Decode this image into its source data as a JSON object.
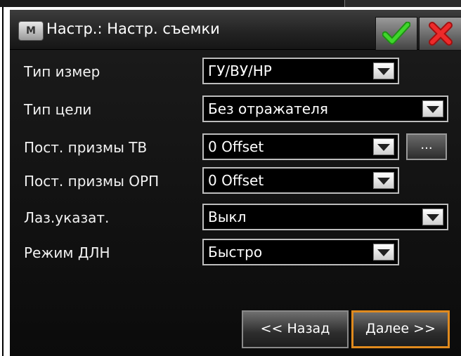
{
  "window": {
    "title": "Настр.: Настр. съемки",
    "app_icon_letter": "M",
    "ok_icon": "green-checkmark-icon",
    "cancel_icon": "red-x-icon"
  },
  "settings": [
    {
      "label": "Тип измер",
      "value": "ГУ/ВУ/НР"
    },
    {
      "label": "Тип цели",
      "value": "Без отражателя"
    },
    {
      "label": "Пост. призмы ТВ",
      "value": "0 Offset",
      "extra_button": "..."
    },
    {
      "label": "Пост. призмы ОРП",
      "value": "0 Offset"
    },
    {
      "label": "Лаз.указат.",
      "value": "Выкл"
    },
    {
      "label": "Режим ДЛН",
      "value": "Быстро"
    }
  ],
  "footer": {
    "back_label": "<< Назад",
    "next_label": "Далее >>"
  },
  "colors": {
    "background": "#0b0b0b",
    "text": "#ffffff",
    "next_border": "#e08a1e",
    "ok_green": "#2fbf1f",
    "cancel_red": "#e02020"
  }
}
